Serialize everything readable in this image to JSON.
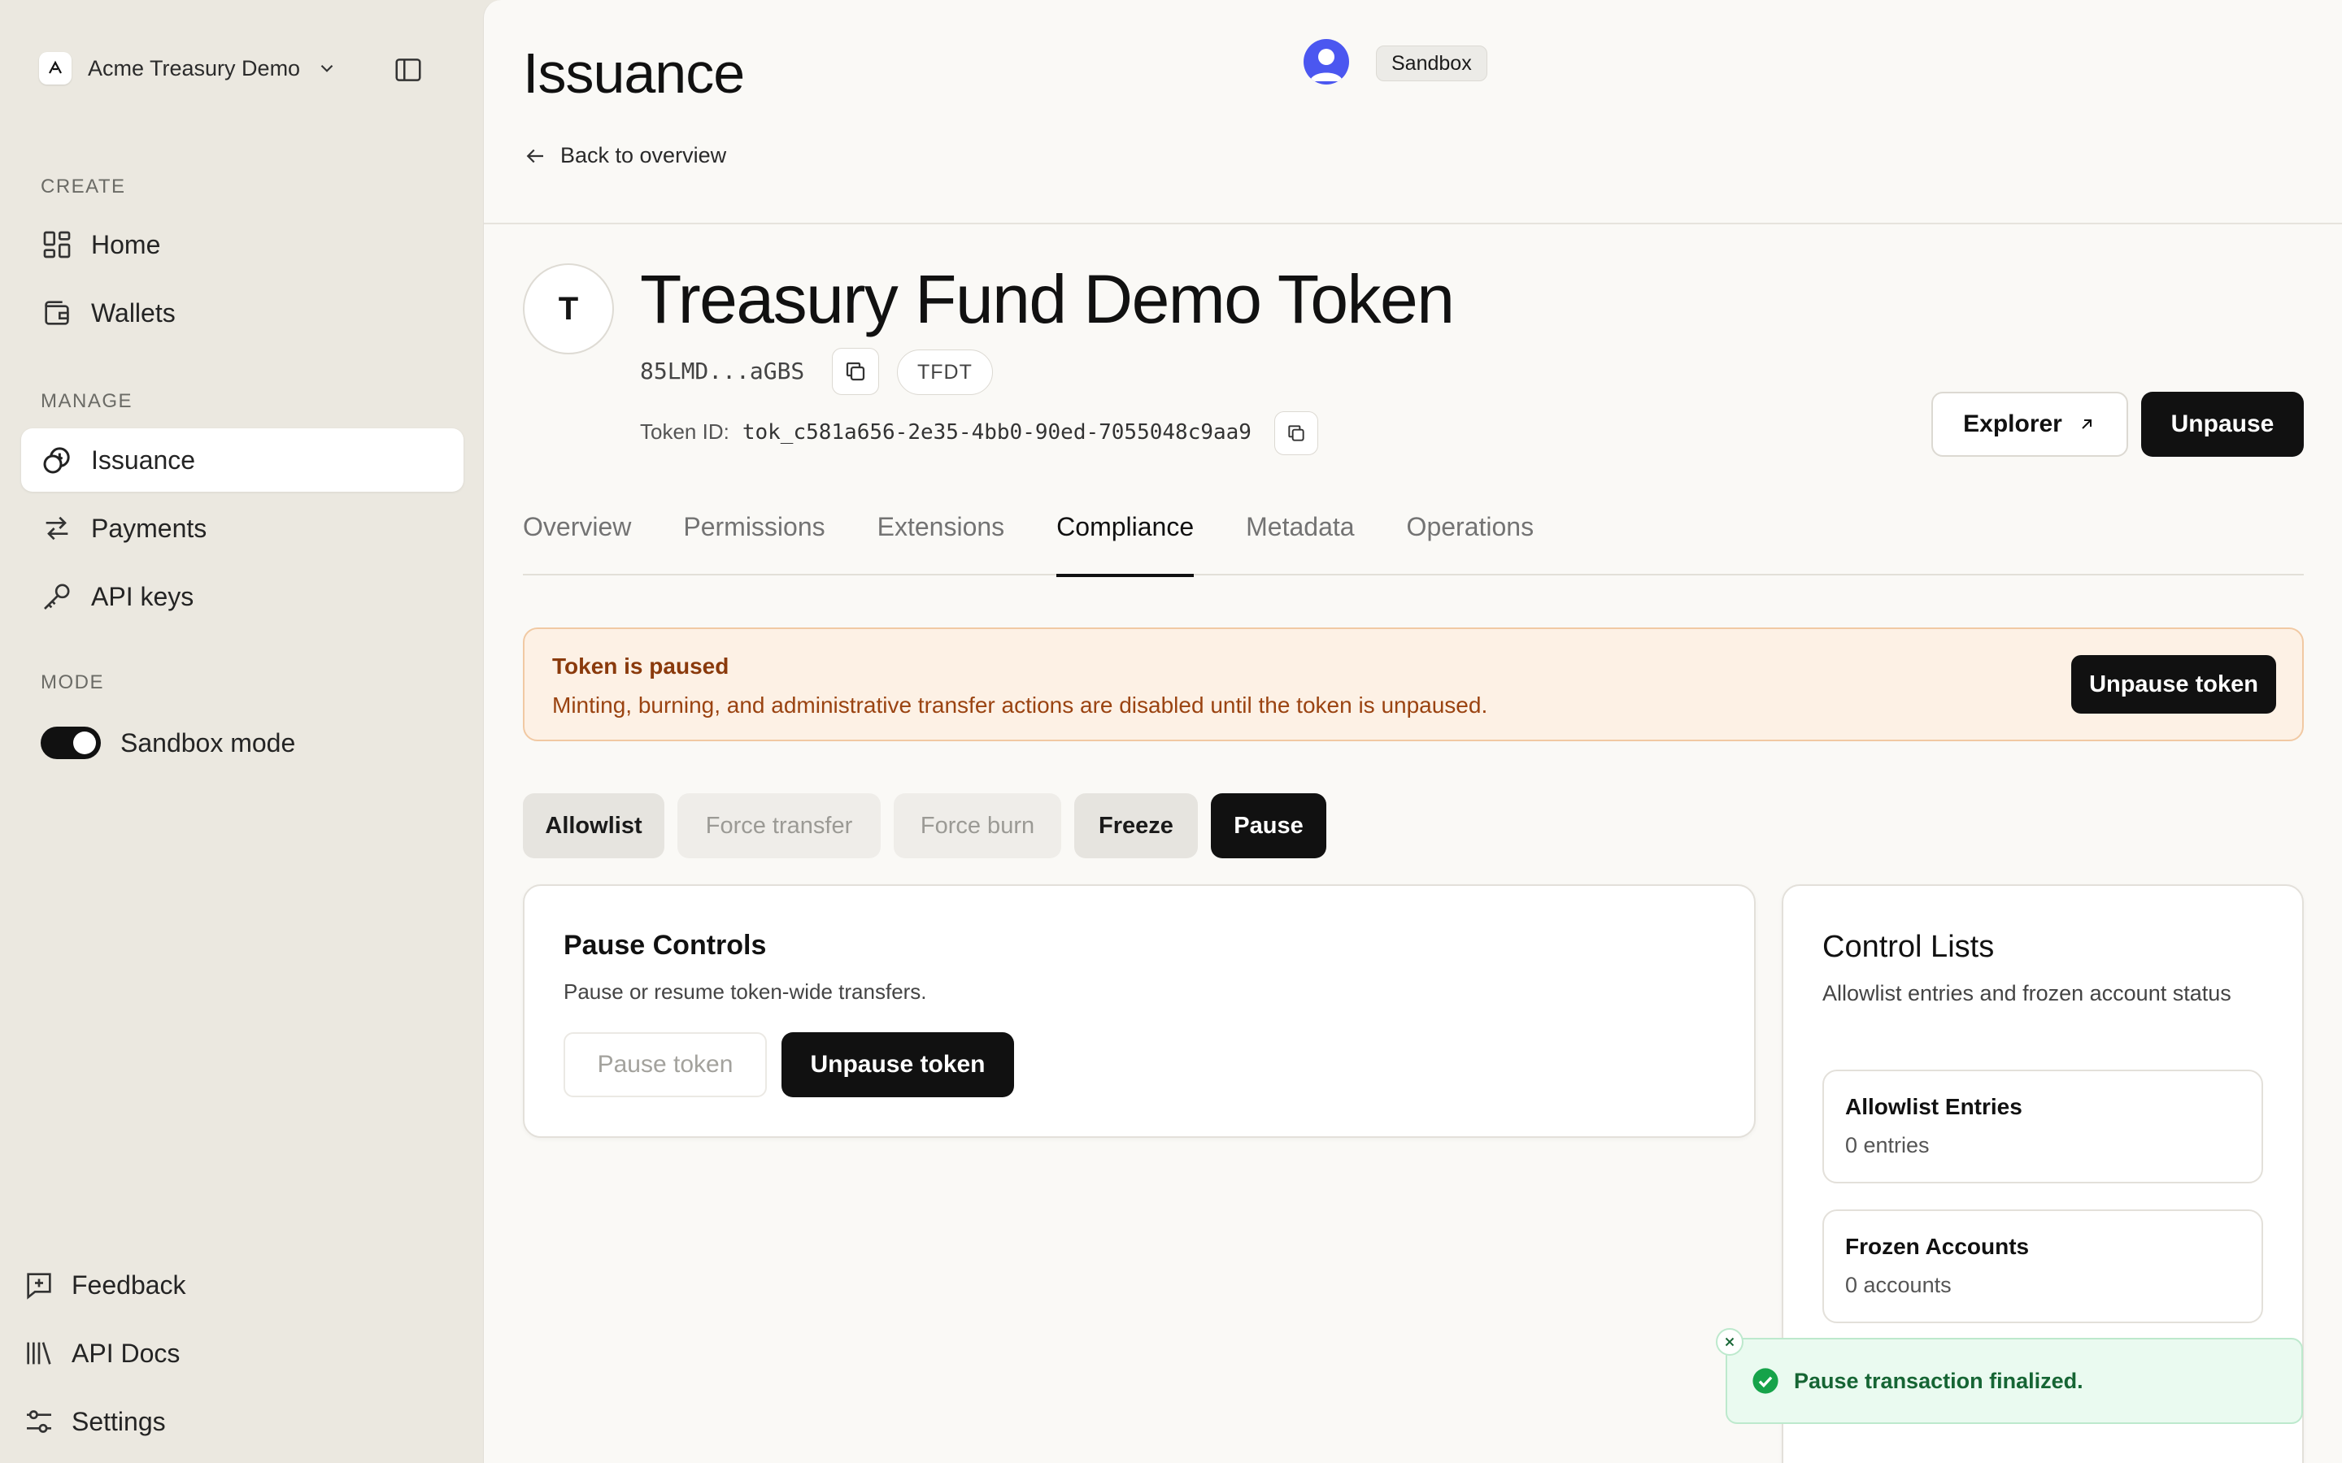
{
  "sidebar": {
    "workspace_name": "Acme Treasury Demo",
    "sections": {
      "create": "CREATE",
      "manage": "MANAGE",
      "mode": "MODE"
    },
    "nav": {
      "home": "Home",
      "wallets": "Wallets",
      "issuance": "Issuance",
      "payments": "Payments",
      "api_keys": "API keys"
    },
    "sandbox_toggle_label": "Sandbox mode",
    "sandbox_enabled": true,
    "bottom": {
      "feedback": "Feedback",
      "api_docs": "API Docs",
      "settings": "Settings"
    }
  },
  "header": {
    "title": "Issuance",
    "back_link": "Back to overview",
    "environment_badge": "Sandbox"
  },
  "token": {
    "initial": "T",
    "name": "Treasury Fund Demo Token",
    "address_short": "85LMD...aGBS",
    "symbol": "TFDT",
    "token_id_label": "Token ID:",
    "token_id": "tok_c581a656-2e35-4bb0-90ed-7055048c9aa9",
    "explorer_button": "Explorer",
    "unpause_button": "Unpause"
  },
  "tabs": [
    {
      "label": "Overview",
      "active": false
    },
    {
      "label": "Permissions",
      "active": false
    },
    {
      "label": "Extensions",
      "active": false
    },
    {
      "label": "Compliance",
      "active": true
    },
    {
      "label": "Metadata",
      "active": false
    },
    {
      "label": "Operations",
      "active": false
    }
  ],
  "alert": {
    "title": "Token is paused",
    "description": "Minting, burning, and administrative transfer actions are disabled until the token is unpaused.",
    "button": "Unpause token"
  },
  "compliance_tabs": [
    {
      "label": "Allowlist",
      "state": "enabled"
    },
    {
      "label": "Force transfer",
      "state": "disabled"
    },
    {
      "label": "Force burn",
      "state": "disabled"
    },
    {
      "label": "Freeze",
      "state": "enabled"
    },
    {
      "label": "Pause",
      "state": "selected"
    }
  ],
  "pause_controls": {
    "title": "Pause Controls",
    "description": "Pause or resume token-wide transfers.",
    "pause_button": "Pause token",
    "unpause_button": "Unpause token"
  },
  "control_lists": {
    "title": "Control Lists",
    "description": "Allowlist entries and frozen account status",
    "allowlist_title": "Allowlist Entries",
    "allowlist_value": "0 entries",
    "frozen_title": "Frozen Accounts",
    "frozen_value": "0 accounts"
  },
  "toast": {
    "message": "Pause transaction finalized."
  },
  "colors": {
    "sidebar_bg": "#ebe8e0",
    "main_bg": "#faf9f6",
    "primary": "#111111",
    "alert_bg": "#fdf1e5",
    "alert_text": "#8a3a0c",
    "toast_bg": "#eafaf0",
    "toast_text": "#166534",
    "avatar": "#4b57f0"
  }
}
